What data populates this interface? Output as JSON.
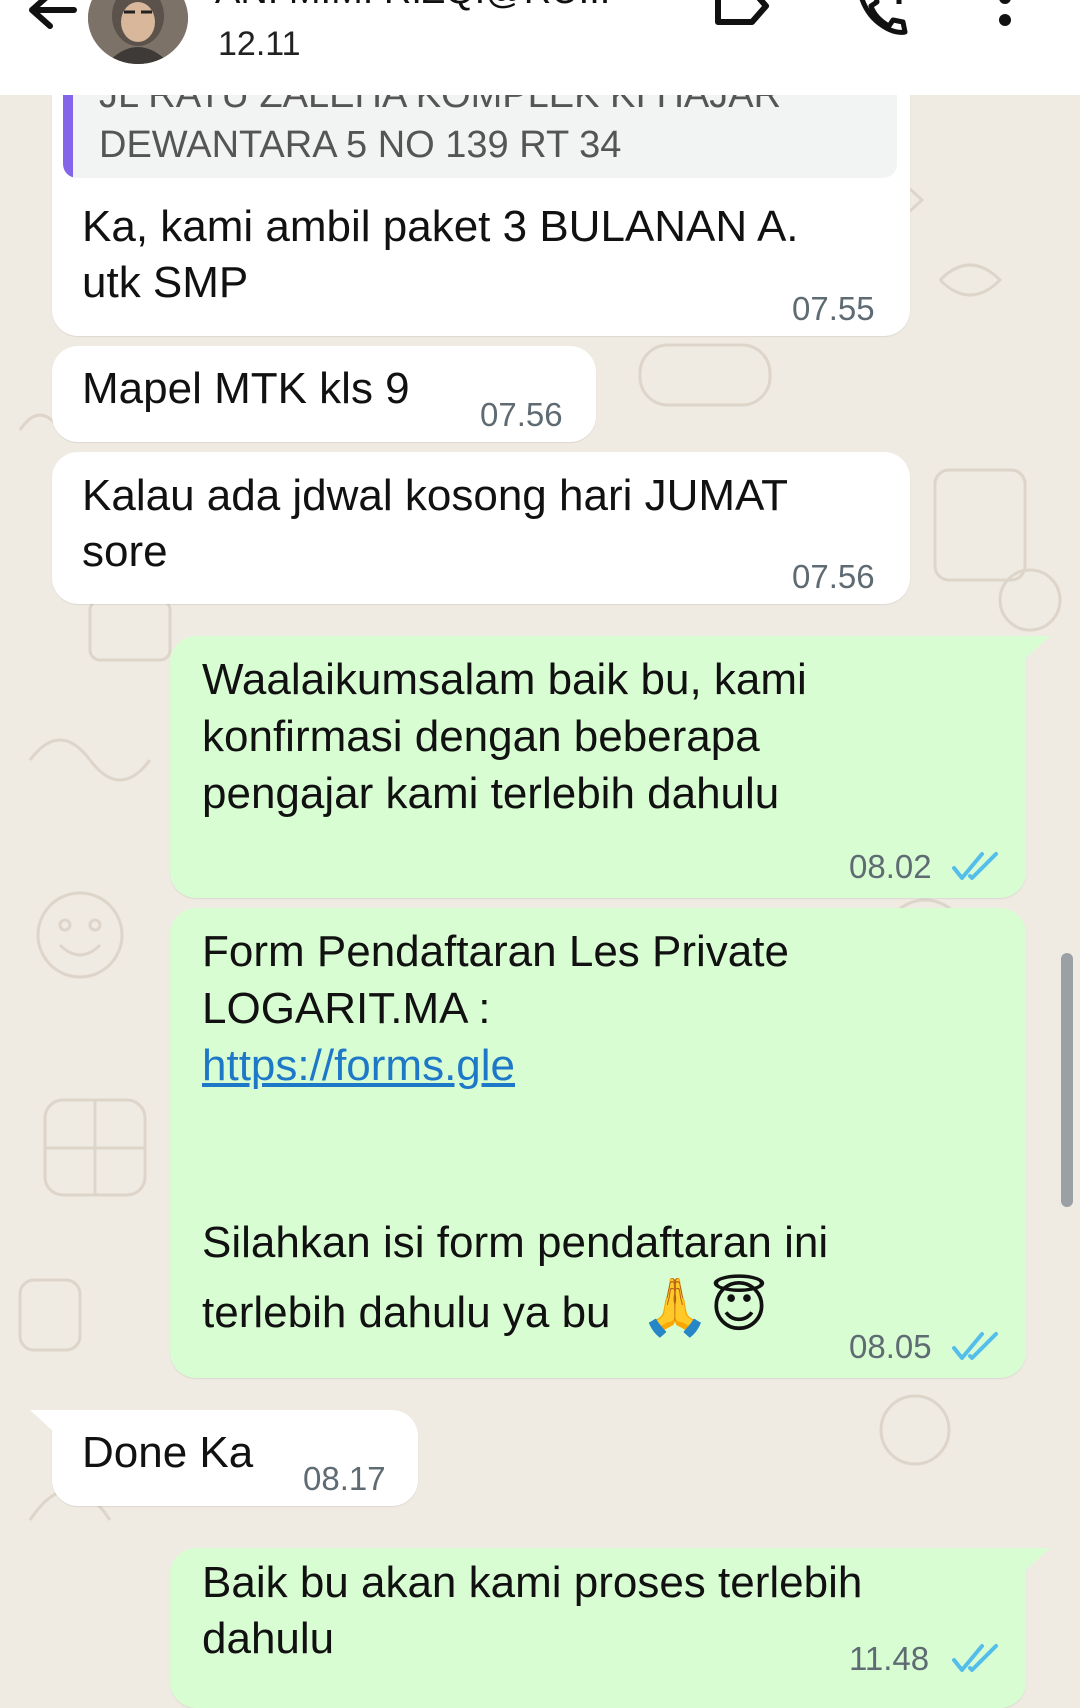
{
  "header": {
    "contact_name": "ANI MIMI RIZQI@RU...",
    "last_seen": "12.11",
    "icons": [
      "back-arrow-icon",
      "avatar",
      "label-tag-icon",
      "add-call-icon",
      "more-vert-icon"
    ]
  },
  "quoted": {
    "line1": "JL RATU ZALEHA KOMPLEK KI HAJAR",
    "line2": "DEWANTARA 5 NO 139 RT 34"
  },
  "messages": [
    {
      "dir": "in",
      "lines": [
        "Ka, kami ambil paket 3 BULANAN A.",
        "utk SMP"
      ],
      "time": "07.55"
    },
    {
      "dir": "in",
      "lines": [
        "Mapel MTK kls 9"
      ],
      "time": "07.56"
    },
    {
      "dir": "in",
      "lines": [
        "Kalau ada jdwal kosong  hari JUMAT",
        "sore"
      ],
      "time": "07.56"
    },
    {
      "dir": "out",
      "lines": [
        "Waalaikumsalam baik bu, kami",
        "konfirmasi dengan beberapa",
        "pengajar kami terlebih dahulu"
      ],
      "time": "08.02",
      "status": "read"
    },
    {
      "dir": "out",
      "lines": [
        "Form Pendaftaran Les Private",
        "LOGARIT.MA :"
      ],
      "link": "https://forms.gle",
      "lines_after": [
        "Silahkan isi form pendaftaran ini",
        "terlebih dahulu ya bu"
      ],
      "emoji": "🙏😇",
      "time": "08.05",
      "status": "read"
    },
    {
      "dir": "in",
      "lines": [
        "Done Ka"
      ],
      "time": "08.17"
    },
    {
      "dir": "out",
      "lines": [
        "Baik bu akan kami proses terlebih",
        "dahulu"
      ],
      "time": "11.48",
      "status": "read"
    }
  ],
  "colors": {
    "incoming_bubble": "#ffffff",
    "outgoing_bubble": "#d9fdd3",
    "read_ticks": "#53bdeb",
    "link": "#1e78c8",
    "quote_bar": "#8464e8"
  }
}
